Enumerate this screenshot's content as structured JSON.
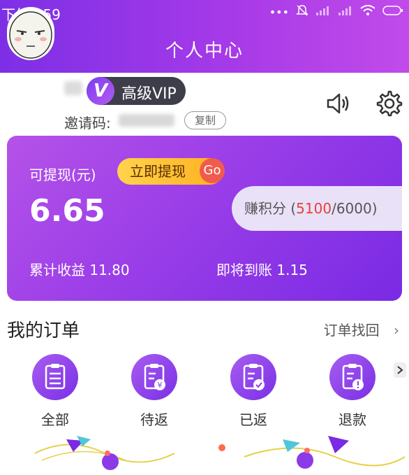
{
  "status_bar": {
    "time": "下午1:59"
  },
  "header": {
    "title": "个人中心"
  },
  "profile": {
    "vip_label": "高级VIP",
    "vip_letter": "V",
    "invite_label": "邀请码:",
    "copy_label": "复制"
  },
  "wallet": {
    "withdraw_label": "可提现(元)",
    "withdraw_button": "立即提现",
    "go_label": "Go",
    "balance": "6.65",
    "points_label": "赚积分 (",
    "points_current": "5100",
    "points_total": "/6000)",
    "cumulative_label": "累计收益 11.80",
    "pending_label": "即将到账 1.15"
  },
  "orders": {
    "title": "我的订单",
    "find_label": "订单找回",
    "items": [
      {
        "label": "全部",
        "icon": "clipboard-list-icon"
      },
      {
        "label": "待返",
        "icon": "clipboard-yen-icon"
      },
      {
        "label": "已返",
        "icon": "clipboard-check-icon"
      },
      {
        "label": "退款",
        "icon": "clipboard-alert-icon"
      }
    ]
  },
  "colors": {
    "header_gradient_start": "#7d2fe6",
    "header_gradient_end": "#c14bea",
    "accent_red": "#e8413a",
    "button_yellow": "#ffd34d"
  }
}
